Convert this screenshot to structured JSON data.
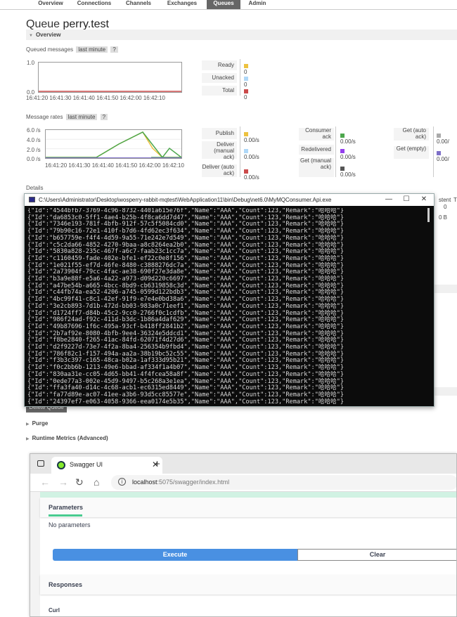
{
  "rabbit": {
    "nav_tabs": [
      "Overview",
      "Connections",
      "Channels",
      "Exchanges",
      "Queues",
      "Admin"
    ],
    "active_tab": "Queues",
    "title_prefix": "Queue",
    "queue_name": "perry.test",
    "overview_section": "Overview",
    "queued_messages": {
      "label": "Queued messages",
      "range": "last minute",
      "help": "?",
      "y_top": "1.0",
      "y_bottom": "0.0",
      "x_ticks": "16:41:20 16:41:30 16:41:40 16:41:50 16:42:00 16:42:10",
      "legend": [
        {
          "name": "Ready",
          "value": "0",
          "color": "#edc240"
        },
        {
          "name": "Unacked",
          "value": "0",
          "color": "#afd8f8"
        },
        {
          "name": "Total",
          "value": "0",
          "color": "#cb4b4b"
        }
      ]
    },
    "message_rates": {
      "label": "Message rates",
      "range": "last minute",
      "help": "?",
      "y_ticks": [
        "6.0 /s",
        "4.0 /s",
        "2.0 /s",
        "0.0 /s"
      ],
      "x_ticks": "16:41:20 16:41:30 16:41:40 16:41:50 16:42:00 16:42:10",
      "col1": [
        {
          "name": "Publish",
          "value": "0.00/s",
          "color": "#edc240"
        },
        {
          "name": "Deliver (manual ack)",
          "value": "0.00/s",
          "color": "#afd8f8"
        },
        {
          "name": "Deliver (auto ack)",
          "value": "0.00/s",
          "color": "#cb4b4b"
        }
      ],
      "col2": [
        {
          "name": "Consumer ack",
          "value": "0.00/s",
          "color": "#4da74d"
        },
        {
          "name": "Redelivered",
          "value": "0.00/s",
          "color": "#9440ed"
        },
        {
          "name": "Get (manual ack)",
          "value": "0.00/s",
          "color": "#555555"
        }
      ],
      "col3": [
        {
          "name": "Get (auto ack)",
          "value": "0.00/",
          "color": "#aaaaaa"
        },
        {
          "name": "Get (empty)",
          "value": "0.00/",
          "color": "#7e6fc8"
        }
      ]
    },
    "details_label": "Details",
    "details_right": {
      "persistent_header": "stent",
      "persistent_count": "0",
      "persistent_bytes": "0 B",
      "extra_t": "T"
    },
    "delete_button": "Delete Queue",
    "purge": "Purge",
    "runtime_metrics": "Runtime Metrics (Advanced)"
  },
  "console": {
    "title": "C:\\Users\\Administrator\\Desktop\\wosperry-rabbit-mqtest\\WebApplication11\\bin\\Debug\\net6.0\\MyMQConsumer.Api.exe",
    "minimize": "—",
    "maximize": "☐",
    "close": "✕",
    "ids": [
      "4544bfb7-3769-4c96-8732-4401a615e76f",
      "da6853c0-5ff1-4ae4-b25b-4f8ca6dd7d47",
      "7346e193-781f-4bfb-912f-57c5f5084cd0",
      "79b90c16-72e1-410f-b7d6-4fd62ec3f634",
      "b657759e-f4f4-4d59-9a55-71e242e7d549",
      "c5c2da66-4852-4270-9baa-a8c8264ea2b0",
      "5830a828-235c-467f-a6c7-faab23c1cc7a",
      "c1160459-fade-402e-bfe1-ef22c0e8f156",
      "1e021f55-ef7d-46fe-8480-c3888276dc7a",
      "2a73904f-79cc-4fac-ae38-690f27e3da8e",
      "b3a9e88f-e5a6-4a22-a973-d09d220c6697",
      "a47be54b-a665-4bcc-8bd9-cb6319858c3d",
      "c44fb74a-ea52-4206-a745-0599d122bdb3",
      "4bc99f41-c8c1-42ef-91f9-e7e4e0bd38a6",
      "3e2cb893-7d1b-472d-bb03-983a0c71eef1",
      "d1724ff7-d84b-45c2-9cc0-2766f0c1cdfb",
      "986f24ad-f92c-411d-b3dc-1b86a4daf629",
      "49b87696-1f6c-495a-93cf-b418ff2841b2",
      "2b7af92e-8080-4bfb-9ee4-36324e5ddcd1",
      "f8be2840-f265-41ac-84fd-62071f4d27d6",
      "d2f9227d-73e7-4f2a-8ba4-256354b9fbd4",
      "786f82c1-f157-494a-aa2a-38b19bc52c55",
      "f3b3c397-c165-48ca-b02a-1af333d95b21",
      "f0c2bb6b-1213-49e6-bbad-af334f1a4b07",
      "830aa31e-cc05-4d65-bb41-4f4fcea58a8f",
      "0ede77a3-002e-45d9-9497-b5c268a3e1ea",
      "ffa3fa40-d14c-4c68-acb1-ec6315ed8449",
      "fa77d89e-ac07-41ee-a3b6-93d5cc85577e",
      "24397ef7-e063-4058-9366-eea0174e5b35"
    ],
    "line_prefix": "{\"Id\":\"",
    "line_suffix": "\",\"Name\":\"AAA\",\"Count\":123,\"Remark\":\"哈哈哈\"}"
  },
  "browser": {
    "tab_title": "Swagger UI",
    "tab_close": "✕",
    "new_tab": "+",
    "url_host": "localhost",
    "url_rest": ":5075/swagger/index.html",
    "back": "←",
    "forward": "→",
    "reload": "↻",
    "home": "⌂",
    "info": "i"
  },
  "swagger": {
    "parameters_heading": "Parameters",
    "no_params": "No parameters",
    "execute": "Execute",
    "clear": "Clear",
    "responses_heading": "Responses",
    "curl": "Curl"
  }
}
